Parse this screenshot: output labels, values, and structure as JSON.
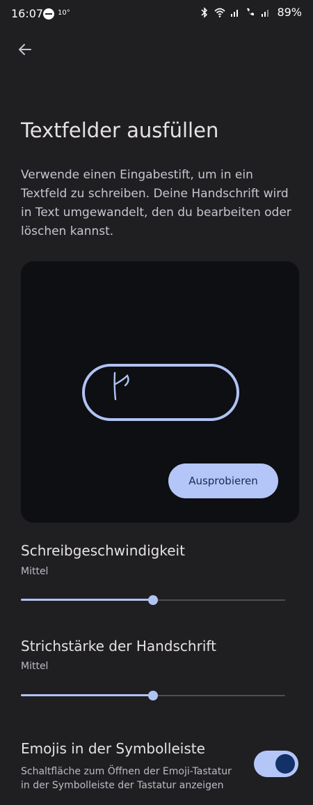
{
  "status_bar": {
    "time": "16:07",
    "temperature": "10°",
    "battery": "89%"
  },
  "page": {
    "title": "Textfelder ausfüllen",
    "description": "Verwende einen Eingabestift, um in ein Textfeld zu schreiben. Deine Handschrift wird in Text umgewandelt, den du bearbeiten oder löschen kannst."
  },
  "demo": {
    "try_button_label": "Ausprobieren"
  },
  "settings": {
    "writing_speed": {
      "title": "Schreibgeschwindigkeit",
      "value_label": "Mittel",
      "level": 0.5
    },
    "stroke_width": {
      "title": "Strichstärke der Handschrift",
      "value_label": "Mittel",
      "level": 0.5
    },
    "emoji_toolbar": {
      "title": "Emojis in der Symbolleiste",
      "description": "Schaltfläche zum Öffnen der Emoji-Tastatur in der Symbolleiste der Tastatur anzeigen",
      "enabled": true
    }
  },
  "icons": {
    "back": "arrow-left-icon",
    "status": [
      "dnd-icon",
      "bluetooth-icon",
      "wifi-icon",
      "signal-icon",
      "call-icon",
      "signal-icon"
    ]
  },
  "colors": {
    "background": "#1f1f22",
    "accent": "#b3c6f7",
    "card": "#0e0f12"
  }
}
